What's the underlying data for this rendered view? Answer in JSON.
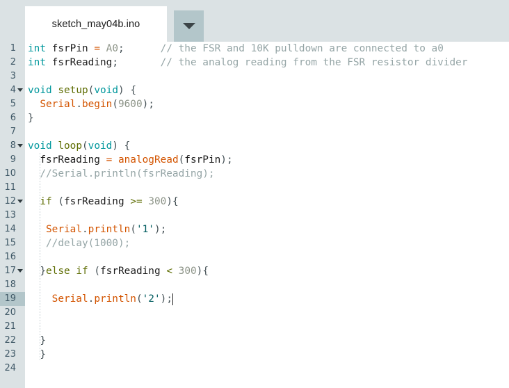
{
  "window": {
    "background_color": "#dbe2e4",
    "editor_background": "#ffffff"
  },
  "tabbar": {
    "tab_label": "sketch_may04b.ino",
    "menu_button_icon": "chevron-down-icon",
    "menu_button_color": "#b3c6ca"
  },
  "editor": {
    "active_line": 19,
    "total_lines": 24,
    "gutter_color": "#dbe2e4",
    "active_line_gutter_color": "#b3c6ca",
    "line_number_color": "#3f5866",
    "colors": {
      "type": "#00979c",
      "function": "#d35400",
      "keyword": "#5e6d03",
      "number": "#8d9488",
      "string": "#005c5f",
      "comment": "#95a5a6",
      "identifier": "#1d1d1d"
    },
    "lines": [
      {
        "n": 1,
        "fold": false,
        "text": "int fsrPin = A0;      // the FSR and 10K pulldown are connected to a0"
      },
      {
        "n": 2,
        "fold": false,
        "text": "int fsrReading;       // the analog reading from the FSR resistor divider"
      },
      {
        "n": 3,
        "fold": false,
        "text": ""
      },
      {
        "n": 4,
        "fold": true,
        "text": "void setup(void) {"
      },
      {
        "n": 5,
        "fold": false,
        "text": "  Serial.begin(9600);"
      },
      {
        "n": 6,
        "fold": false,
        "text": "}"
      },
      {
        "n": 7,
        "fold": false,
        "text": ""
      },
      {
        "n": 8,
        "fold": true,
        "text": "void loop(void) {"
      },
      {
        "n": 9,
        "fold": false,
        "text": "  fsrReading = analogRead(fsrPin);"
      },
      {
        "n": 10,
        "fold": false,
        "text": "  //Serial.println(fsrReading);"
      },
      {
        "n": 11,
        "fold": false,
        "text": ""
      },
      {
        "n": 12,
        "fold": true,
        "text": "  if (fsrReading >= 300){"
      },
      {
        "n": 13,
        "fold": false,
        "text": ""
      },
      {
        "n": 14,
        "fold": false,
        "text": "   Serial.println('1');"
      },
      {
        "n": 15,
        "fold": false,
        "text": "   //delay(1000);"
      },
      {
        "n": 16,
        "fold": false,
        "text": ""
      },
      {
        "n": 17,
        "fold": true,
        "text": "  }else if (fsrReading < 300){"
      },
      {
        "n": 18,
        "fold": false,
        "text": ""
      },
      {
        "n": 19,
        "fold": false,
        "text": "    Serial.println('2');"
      },
      {
        "n": 20,
        "fold": false,
        "text": ""
      },
      {
        "n": 21,
        "fold": false,
        "text": ""
      },
      {
        "n": 22,
        "fold": false,
        "text": "  }"
      },
      {
        "n": 23,
        "fold": false,
        "text": "  }"
      },
      {
        "n": 24,
        "fold": false,
        "text": ""
      }
    ]
  }
}
